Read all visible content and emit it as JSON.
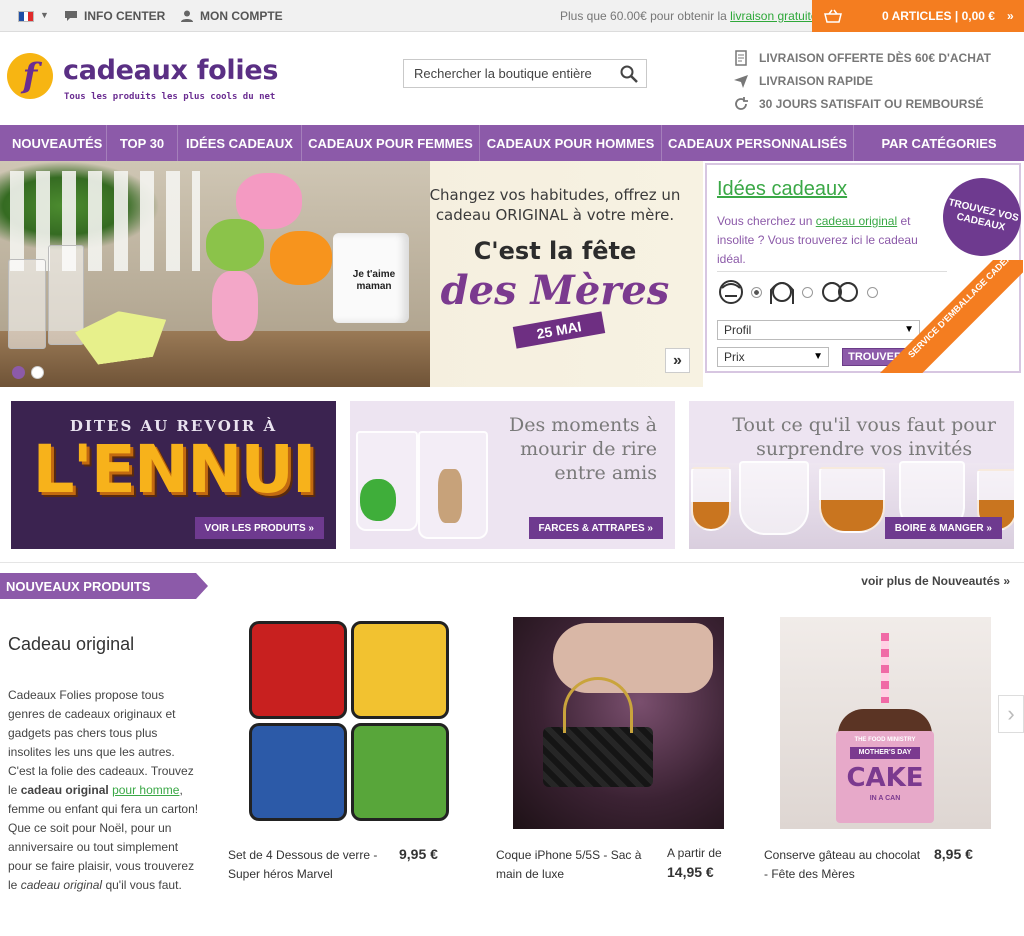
{
  "topbar": {
    "language_flag": "fr-flag-icon",
    "info_center": "INFO CENTER",
    "account": "MON COMPTE",
    "promo_prefix": "Plus que 60.00€ pour obtenir la",
    "promo_link": "livraison gratuite",
    "cart_label": "0 ARTICLES | 0,00 €",
    "cart_chevron": "»"
  },
  "header": {
    "logo_letter": "f",
    "logo_name": "cadeaux folies",
    "logo_tagline": "Tous les produits les plus cools du net",
    "search_placeholder": "Rechercher la boutique entière",
    "benefits": [
      {
        "icon": "document-icon",
        "label": "LIVRAISON OFFERTE DÈS 60€ D'ACHAT"
      },
      {
        "icon": "plane-icon",
        "label": "LIVRAISON RAPIDE"
      },
      {
        "icon": "refresh-icon",
        "label": "30 JOURS SATISFAIT OU REMBOURSÉ"
      }
    ]
  },
  "nav": {
    "items": [
      "NOUVEAUTÉS",
      "TOP 30",
      "IDÉES CADEAUX",
      "CADEAUX POUR FEMMES",
      "CADEAUX POUR HOMMES",
      "CADEAUX PERSONNALISÉS",
      "PAR CATÉGORIES"
    ]
  },
  "hero": {
    "line1": "Changez vos habitudes, offrez un",
    "line1b": "cadeau ORIGINAL à votre mère.",
    "line2": "C'est la fête",
    "line3": "des Mères",
    "date": "25 MAI",
    "mug_text": "Je t'aime maman",
    "next": "»",
    "slides_total": 2,
    "slide_active": 1
  },
  "ideas": {
    "title": "Idées cadeaux",
    "desc_pre": "Vous cherchez un",
    "desc_link": "cadeau original",
    "desc_post": "et insolite ? Vous trouverez ici le cadeau idéal.",
    "profile_select": "Profil",
    "price_select": "Prix",
    "find_button": "TROUVER",
    "burst": "TROUVEZ VOS CADEAUX",
    "corner": "SERVICE D'EMBALLAGE CADEAU"
  },
  "tiles": [
    {
      "heading": "DITES AU REVOIR À",
      "big": "L'ENNUI",
      "cta": "VOIR LES PRODUITS »"
    },
    {
      "heading": "Des moments à mourir de rire entre amis",
      "line1": "Des moments à",
      "line2": "mourir de rire",
      "line3": "entre amis",
      "cta": "FARCES & ATTRAPES »"
    },
    {
      "heading": "Tout ce qu'il vous faut pour surprendre vos invités",
      "line1": "Tout ce qu'il vous faut pour",
      "line2": "surprendre vos invités",
      "cta": "BOIRE & MANGER »"
    }
  ],
  "new_products": {
    "label": "NOUVEAUX PRODUITS",
    "more": "voir plus de Nouveautés »",
    "intro_title": "Cadeau original",
    "intro_p1": "Cadeaux Folies propose tous genres de cadeaux originaux et gadgets pas chers tous plus insolites les uns que les autres. C'est la folie des cadeaux. Trouvez le",
    "intro_bold": "cadeau original",
    "intro_link": "pour homme",
    "intro_p2": ", femme ou enfant qui fera un carton! Que ce soit pour Noël, pour un anniversaire ou tout simplement pour se faire plaisir, vous trouverez le",
    "intro_italic": "cadeau original",
    "intro_p3": "qu'il vous faut.",
    "products": [
      {
        "name": "Set de 4 Dessous de verre - Super héros Marvel",
        "price": "9,95 €",
        "price_prefix": ""
      },
      {
        "name": "Coque iPhone 5/5S - Sac à main de luxe",
        "price": "14,95 €",
        "price_prefix": "A partir de"
      },
      {
        "name": "Conserve gâteau au chocolat - Fête des Mères",
        "price": "8,95 €",
        "price_prefix": ""
      }
    ],
    "cake_tin_text": "CAKE",
    "cake_tin_sub": "IN A CAN",
    "cake_tin_label": "MOTHER'S DAY",
    "cake_tin_brand": "THE FOOD MINISTRY"
  },
  "colors": {
    "brand_purple": "#8c5aa9",
    "dark_purple": "#6e3a8f",
    "accent_orange": "#f47d20",
    "link_green": "#3aa846",
    "logo_yellow": "#f7b512"
  }
}
